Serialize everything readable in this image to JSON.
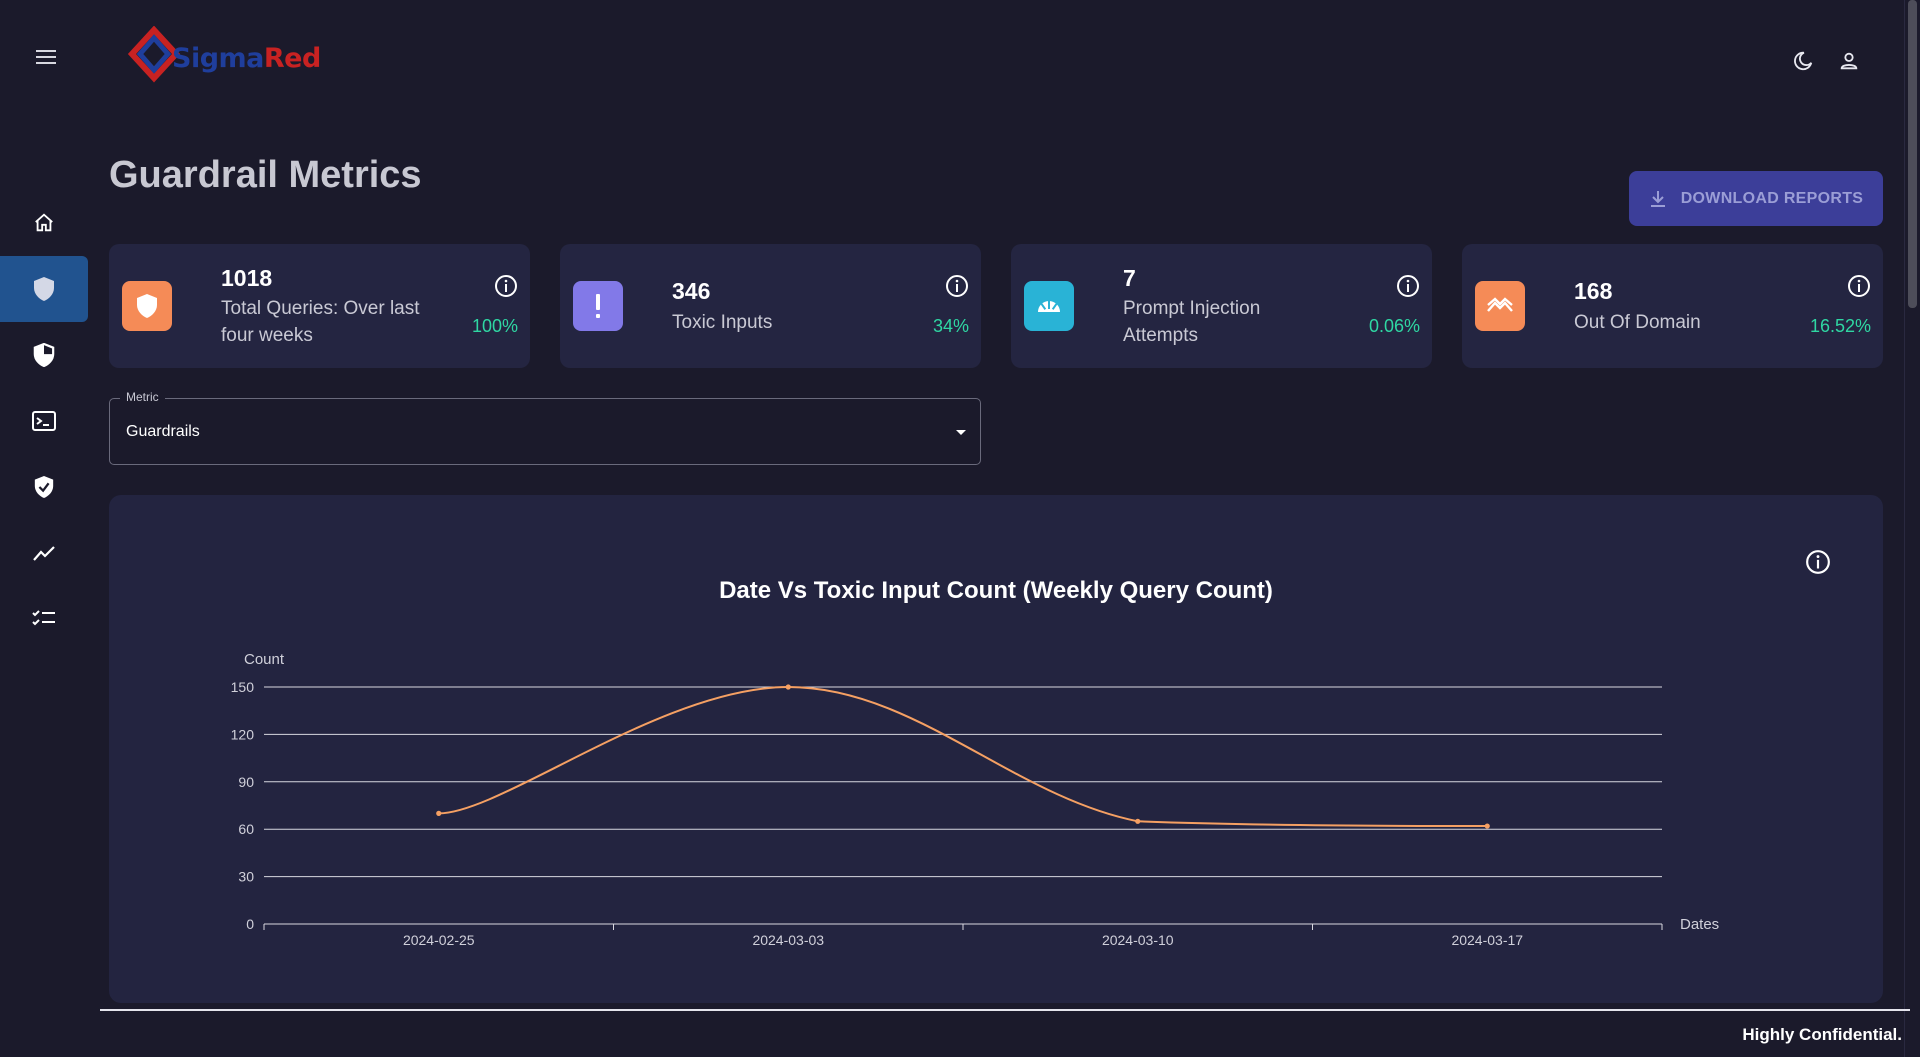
{
  "app": {
    "logo_text_a": "Sigma",
    "logo_text_b": "Red",
    "menu_icon": "hamburger-menu-icon",
    "theme_icon": "moon-icon",
    "account_icon": "person-icon"
  },
  "sidebar": {
    "items": [
      {
        "icon": "home-icon",
        "active": false
      },
      {
        "icon": "shield-icon",
        "active": true
      },
      {
        "icon": "shield-half-icon",
        "active": false
      },
      {
        "icon": "terminal-icon",
        "active": false
      },
      {
        "icon": "shield-check-icon",
        "active": false
      },
      {
        "icon": "trending-icon",
        "active": false
      },
      {
        "icon": "checklist-icon",
        "active": false
      }
    ]
  },
  "header": {
    "title": "Guardrail Metrics",
    "download_label": "DOWNLOAD REPORTS"
  },
  "cards": [
    {
      "value": "1018",
      "label": "Total Queries: Over last four weeks",
      "pct": "100%",
      "icon": "shield-icon",
      "color": "#f58b57"
    },
    {
      "value": "346",
      "label": "Toxic Inputs",
      "pct": "34%",
      "icon": "exclamation-icon",
      "color": "#8279e8"
    },
    {
      "value": "7",
      "label": "Prompt Injection Attempts",
      "pct": "0.06%",
      "icon": "injection-icon",
      "color": "#29b3d6"
    },
    {
      "value": "168",
      "label": "Out Of Domain",
      "pct": "16.52%",
      "icon": "zigzag-icon",
      "color": "#f58b57"
    }
  ],
  "metric_select": {
    "legend": "Metric",
    "value": "Guardrails"
  },
  "chart_data": {
    "type": "line",
    "title": "Date Vs Toxic Input Count (Weekly Query Count)",
    "xlabel": "Dates",
    "ylabel": "Count",
    "categories": [
      "2024-02-25",
      "2024-03-03",
      "2024-03-10",
      "2024-03-17"
    ],
    "values": [
      70,
      150,
      65,
      62
    ],
    "ylim": [
      0,
      150
    ],
    "yticks": [
      0,
      30,
      60,
      90,
      120,
      150
    ],
    "grid": true,
    "line_color": "#f5a063"
  },
  "footer": {
    "text": "Highly Confidential."
  }
}
